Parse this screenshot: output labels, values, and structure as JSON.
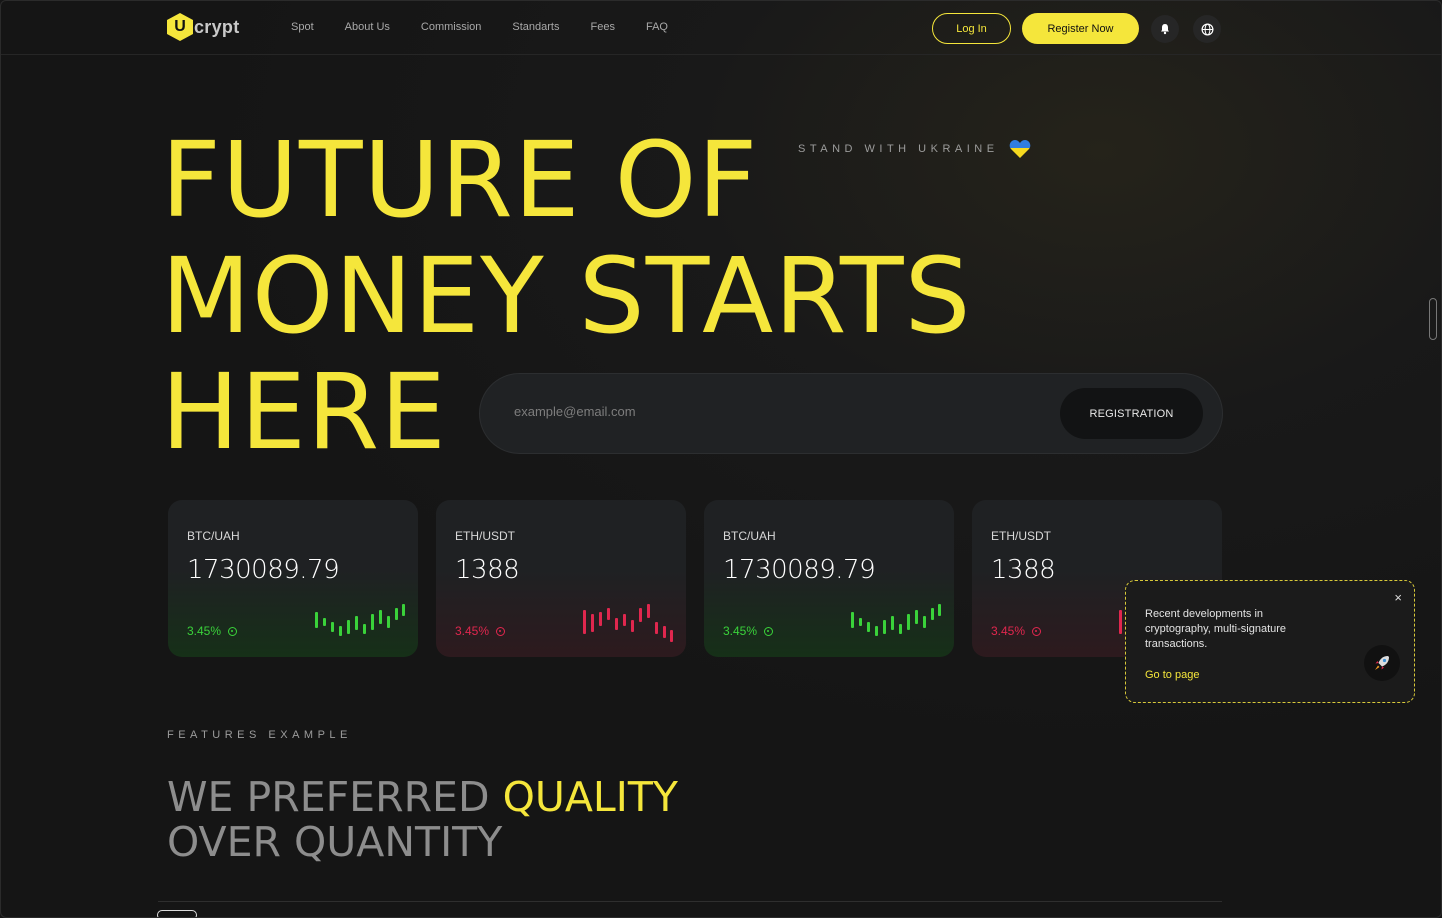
{
  "header": {
    "logo_letter": "U",
    "logo_text": "crypt",
    "nav": [
      "Spot",
      "About Us",
      "Commission",
      "Standarts",
      "Fees",
      "FAQ"
    ],
    "login_label": "Log In",
    "register_label": "Register Now"
  },
  "hero": {
    "line1": "FUTURE OF",
    "line2": "MONEY STARTS",
    "line3": "HERE",
    "stand": "STAND WITH UKRAINE",
    "email_placeholder": "example@email.com",
    "registration_label": "REGISTRATION"
  },
  "tickers": [
    {
      "pair": "BTC/UAH",
      "price": "1730089.79",
      "change": "3.45%",
      "trend": "up"
    },
    {
      "pair": "ETH/USDT",
      "price": "1388",
      "change": "3.45%",
      "trend": "down"
    },
    {
      "pair": "BTC/UAH",
      "price": "1730089.79",
      "change": "3.45%",
      "trend": "up"
    },
    {
      "pair": "ETH/USDT",
      "price": "1388",
      "change": "3.45%",
      "trend": "down"
    }
  ],
  "popup": {
    "text": "Recent developments in cryptography, multi-signature transactions.",
    "link": "Go to page",
    "close": "×"
  },
  "features": {
    "label": "FEATURES EXAMPLE",
    "title_a": "WE PREFERRED ",
    "title_b": "QUALITY",
    "title_c": "OVER QUANTITY"
  },
  "colors": {
    "accent": "#f5e63b",
    "up": "#3ad23a",
    "down": "#e0274e",
    "background": "#161616"
  },
  "icons": [
    "bell-icon",
    "globe-icon",
    "heart-icon",
    "rocket-icon",
    "close-icon"
  ]
}
